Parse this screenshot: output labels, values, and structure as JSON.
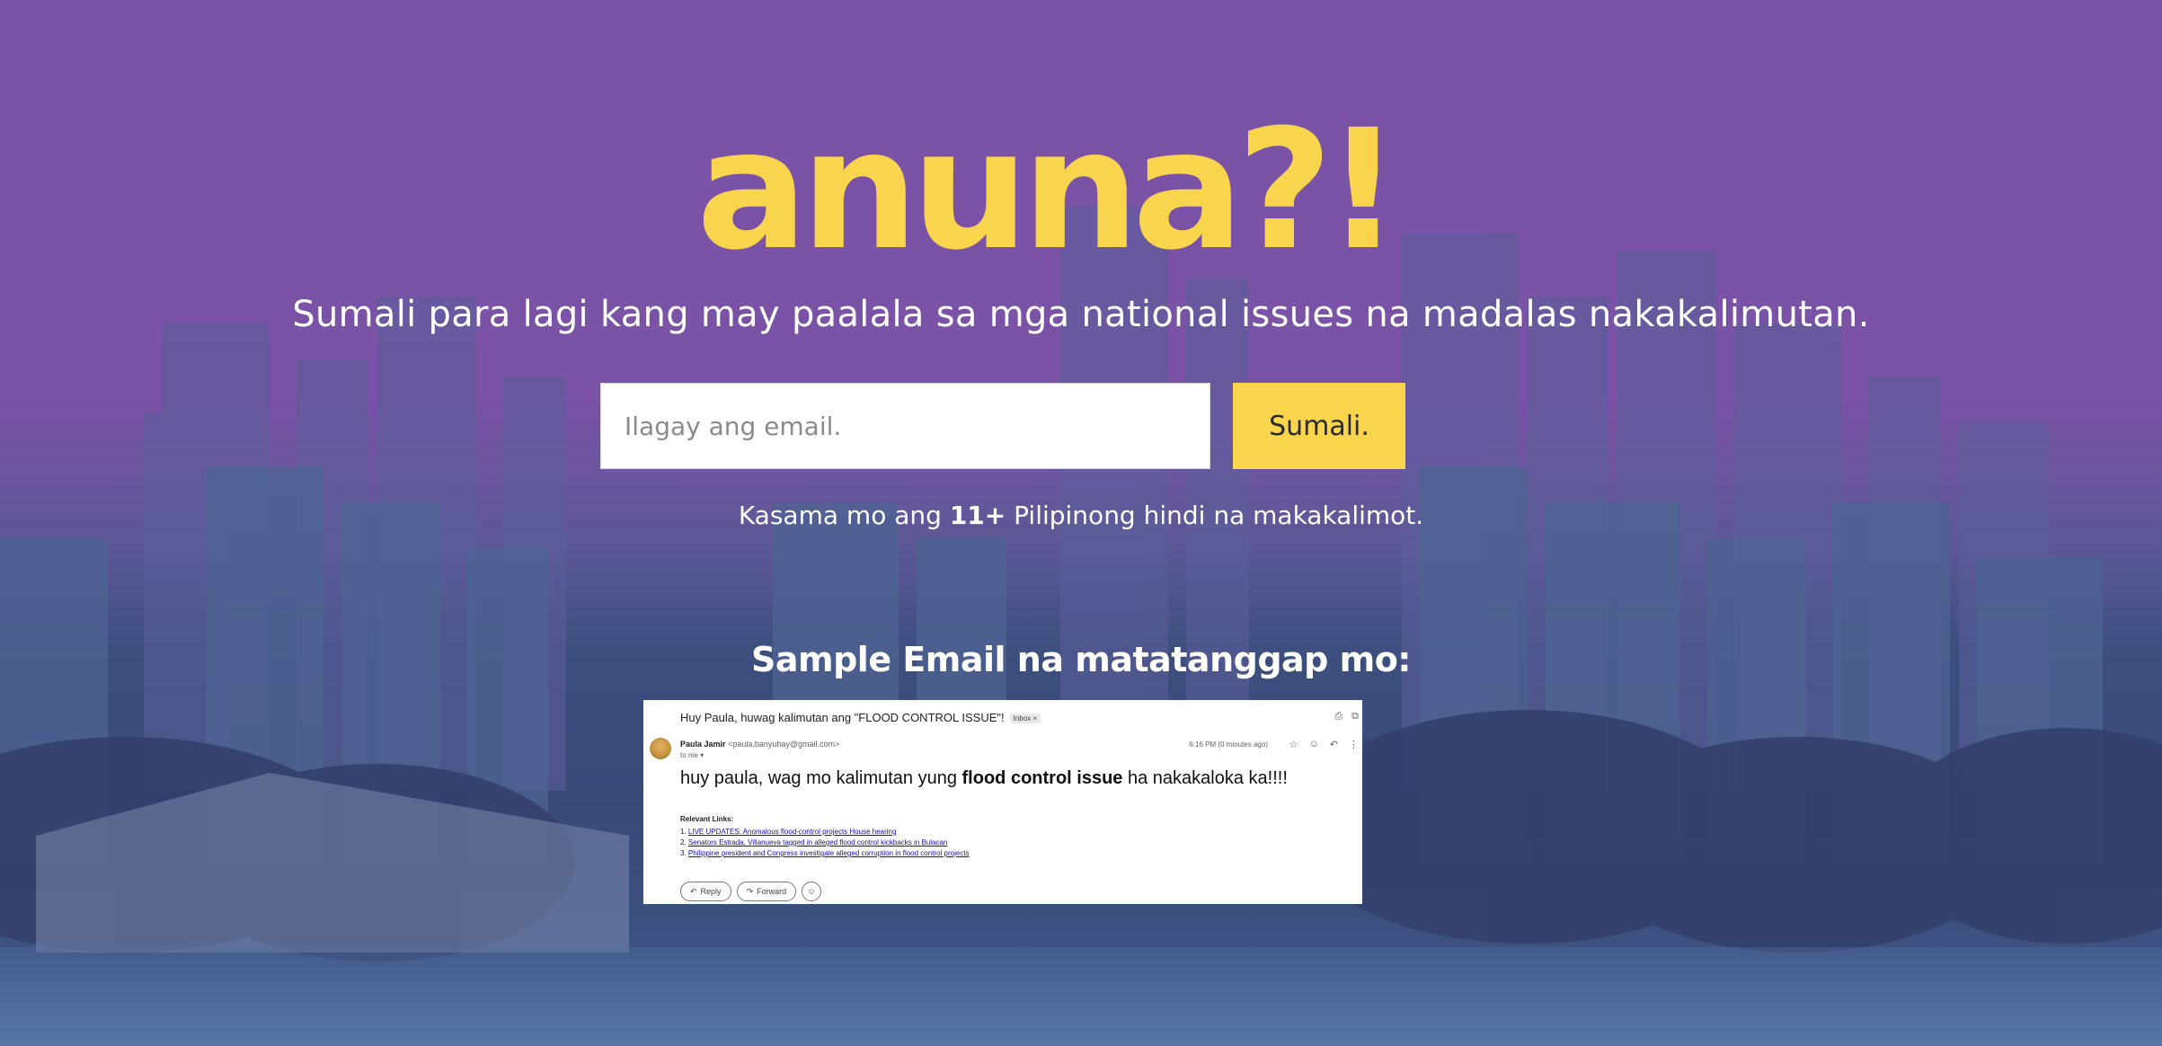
{
  "brand": {
    "logo": "anuna?!",
    "accent_color": "#f9d54d",
    "background_color": "#7a52a6"
  },
  "hero": {
    "tagline": "Sumali para lagi kang may paalala sa mga national issues na madalas nakakalimutan."
  },
  "signup": {
    "email_placeholder": "Ilagay ang email.",
    "email_value": "",
    "join_label": "Sumali."
  },
  "counter": {
    "prefix": "Kasama mo ang ",
    "count": "11+",
    "suffix": " Pilipinong hindi na makakalimot."
  },
  "sample": {
    "heading": "Sample Email na matatanggap mo:",
    "email": {
      "subject": "Huy Paula, huwag kalimutan ang \"FLOOD CONTROL ISSUE\"!",
      "label": "Inbox ×",
      "sender_name": "Paula Jamir",
      "sender_email": "<paula.banyuhay@gmail.com>",
      "to": "to me ▾",
      "time": "6:16 PM (0 minutes ago)",
      "body_prefix": "huy paula, wag mo kalimutan yung ",
      "body_bold": "flood control issue",
      "body_suffix": " ha nakakaloka ka!!!!",
      "links_title": "Relevant Links:",
      "links": [
        {
          "num": "1.",
          "text": "LIVE UPDATES: Anomalous flood-control projects House hearing"
        },
        {
          "num": "2.",
          "text": "Senators Estrada, Villanueva tagged in alleged flood control kickbacks in Bulacan"
        },
        {
          "num": "3.",
          "text": "Philippine president and Congress investigate alleged corruption in flood control projects"
        }
      ],
      "reply_label": "Reply",
      "forward_label": "Forward"
    }
  }
}
